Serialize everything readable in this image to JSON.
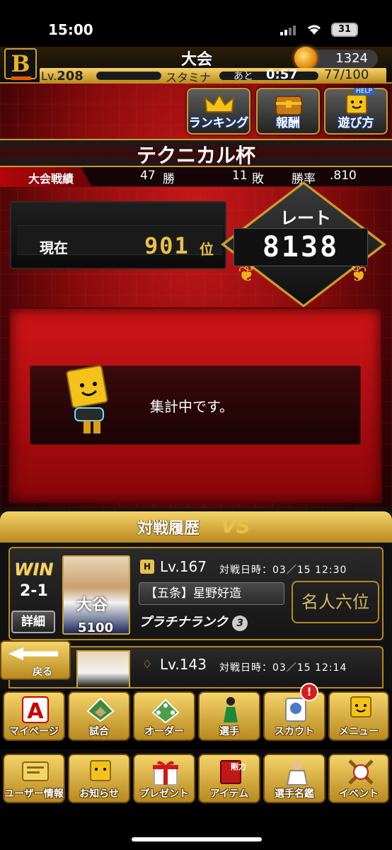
{
  "status": {
    "time": "15:00",
    "battery": "31"
  },
  "header": {
    "title": "大会",
    "coins": "1324",
    "level_label": "Lv.",
    "level": "208",
    "stamina_label": "スタミナ",
    "ato_label": "あと",
    "timer": "0:57",
    "stamina": "77/100",
    "logo": "B"
  },
  "nav": [
    {
      "label": "ランキング",
      "icon": "crown-icon"
    },
    {
      "label": "報酬",
      "icon": "treasure-chest-icon"
    },
    {
      "label": "遊び方",
      "icon": "help-mascot-icon",
      "badge": "HELP"
    }
  ],
  "tournament": {
    "title": "テクニカル杯"
  },
  "record": {
    "label": "大会戦績",
    "wins": "47",
    "wins_unit": "勝",
    "losses": "11",
    "losses_unit": "敗",
    "rate_label": "勝率",
    "rate": ".810"
  },
  "rank": {
    "label": "現在",
    "value": "901",
    "unit": "位"
  },
  "rating": {
    "label": "レート",
    "value": "8138"
  },
  "message": {
    "text": "集計中です。"
  },
  "history": {
    "title": "対戦履歴",
    "vs": "VS",
    "entries": [
      {
        "result": "WIN",
        "score": "2-1",
        "detail": "詳細",
        "player_name": "大谷",
        "player_power": "5100",
        "level": "Lv.167",
        "date": "対戦日時：03／15 12:30",
        "opponent": "【五条】星野好造",
        "rank_text": "プラチナランク",
        "rank_num": "3",
        "title_badge": "名人六位"
      },
      {
        "level": "Lv.143",
        "date": "対戦日時：03／15 12:14"
      }
    ]
  },
  "back": {
    "label": "戻る"
  },
  "menu_row1": [
    {
      "label": "マイページ",
      "icon": "letter-a-icon"
    },
    {
      "label": "試合",
      "icon": "stadium-icon"
    },
    {
      "label": "オーダー",
      "icon": "field-order-icon"
    },
    {
      "label": "選手",
      "icon": "player-icon"
    },
    {
      "label": "スカウト",
      "icon": "scout-icon",
      "notif": "!"
    },
    {
      "label": "メニュー",
      "icon": "mascot-menu-icon"
    }
  ],
  "menu_row2": [
    {
      "label": "ユーザー情報",
      "icon": "user-info-icon"
    },
    {
      "label": "お知らせ",
      "icon": "mascot-notice-icon"
    },
    {
      "label": "プレゼント",
      "icon": "gift-icon"
    },
    {
      "label": "アイテム",
      "icon": "item-book-icon",
      "tag": "剛力"
    },
    {
      "label": "選手名鑑",
      "icon": "player-catalog-icon"
    },
    {
      "label": "イベント",
      "icon": "baseball-event-icon"
    }
  ]
}
